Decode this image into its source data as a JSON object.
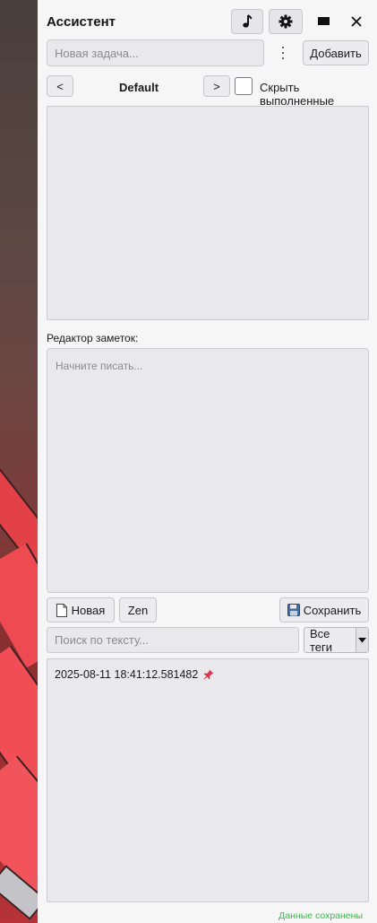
{
  "app": {
    "title": "Ассистент"
  },
  "header": {
    "music_icon": "music-note-icon",
    "settings_icon": "gear-icon",
    "minimize_icon": "minimize-icon",
    "close_icon": "close-icon"
  },
  "tasks": {
    "new_task_placeholder": "Новая задача...",
    "more_icon": "vertical-dots-icon",
    "add_label": "Добавить",
    "prev_label": "<",
    "list_name": "Default",
    "next_label": ">",
    "hide_done_label": "Скрыть выполненные",
    "hide_done_checked": false
  },
  "editor": {
    "label": "Редактор заметок:",
    "placeholder": "Начните писать...",
    "new_label": "Новая",
    "zen_label": "Zen",
    "save_label": "Сохранить"
  },
  "notes": {
    "search_placeholder": "Поиск по тексту...",
    "tags_selected": "Все теги",
    "items": [
      {
        "title": "2025-08-11 18:41:12.581482",
        "pinned": true
      }
    ]
  },
  "status": {
    "text": "Данные сохранены"
  },
  "colors": {
    "pin": "#d9364f",
    "status": "#3cb54a"
  }
}
